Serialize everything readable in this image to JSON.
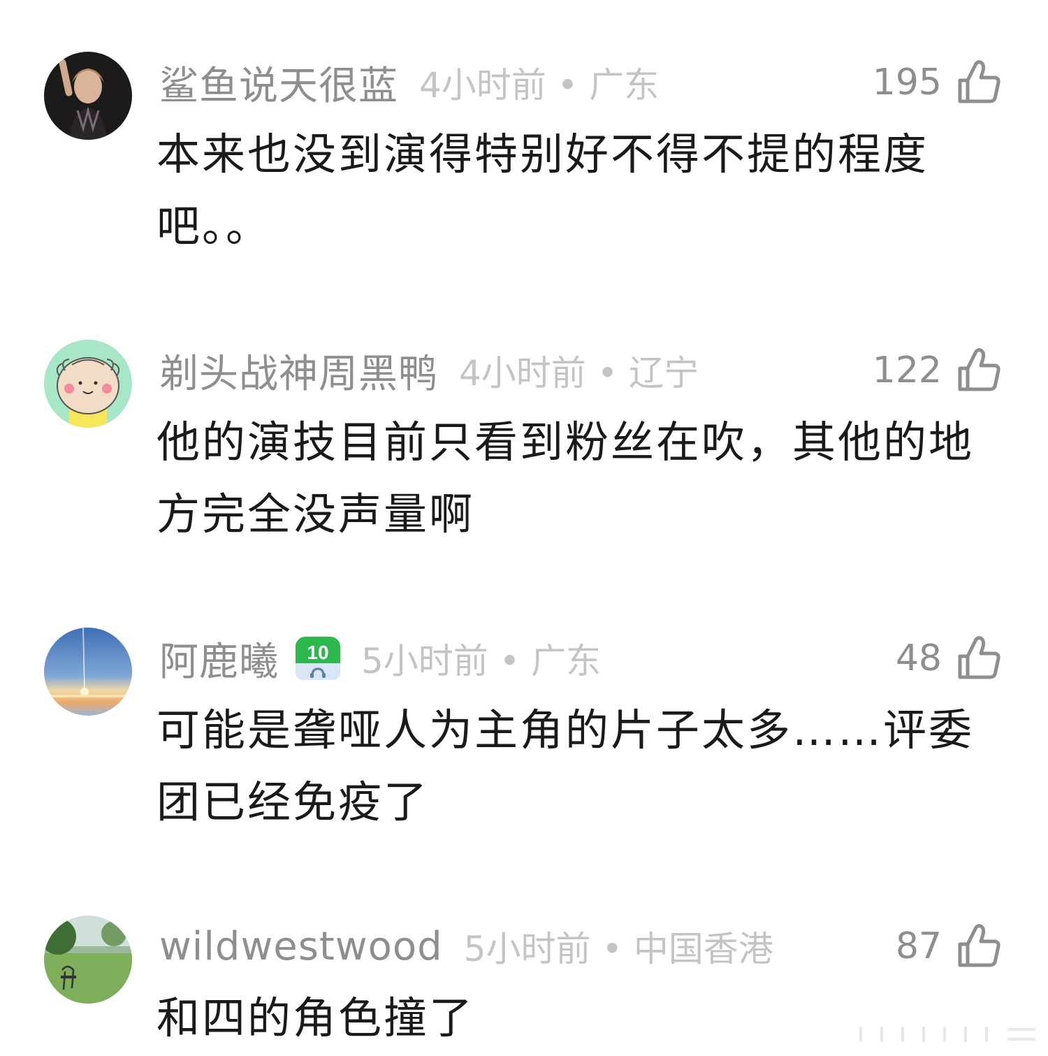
{
  "comments": [
    {
      "username": "鲨鱼说天很蓝",
      "time_location": "4小时前 • 广东",
      "likes": "195",
      "text": "本来也没到演得特别好不得不提的程度吧。。",
      "avatar_icon": "avatar-photo-performer"
    },
    {
      "username": "剃头战神周黑鸭",
      "time_location": "4小时前 • 辽宁",
      "likes": "122",
      "text": "他的演技目前只看到粉丝在吹，其他的地方完全没声量啊",
      "avatar_icon": "avatar-cartoon-grandpa"
    },
    {
      "username": "阿鹿曦",
      "badge": "10",
      "time_location": "5小时前 • 广东",
      "likes": "48",
      "text": "可能是聋哑人为主角的片子太多……评委团已经免疫了",
      "avatar_icon": "avatar-sky-sunset"
    },
    {
      "username": "wildwestwood",
      "time_location": "5小时前 • 中国香港",
      "likes": "87",
      "text": "和四的角色撞了",
      "avatar_icon": "avatar-meadow-chair"
    }
  ],
  "colors": {
    "username": "#8e8e8e",
    "meta": "#c4c4c4",
    "body": "#1a1a1a",
    "badge_green": "#2db84d"
  }
}
